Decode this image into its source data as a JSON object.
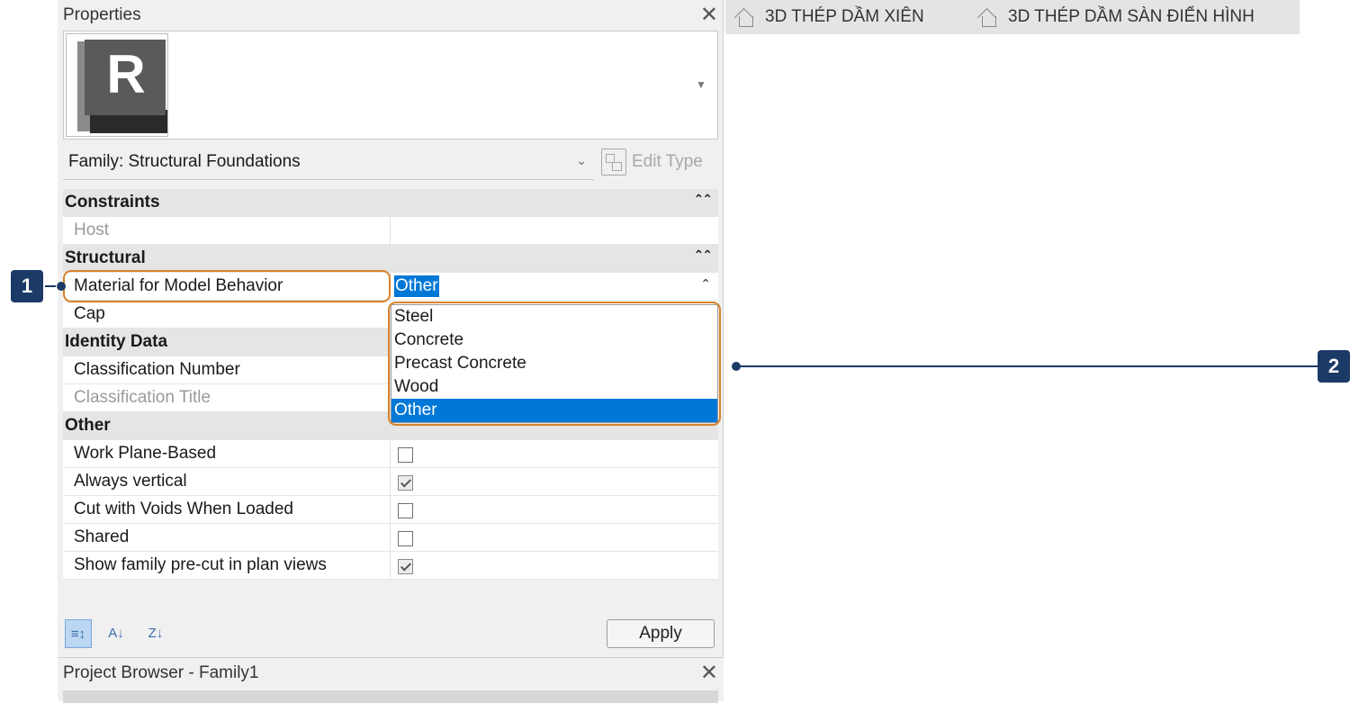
{
  "properties_panel": {
    "title": "Properties",
    "type_logo_letter": "R",
    "family_label": "Family: Structural Foundations",
    "edit_type_label": "Edit Type",
    "groups": {
      "constraints": "Constraints",
      "structural": "Structural",
      "identity": "Identity Data",
      "other": "Other"
    },
    "rows": {
      "host": "Host",
      "material": "Material for Model Behavior",
      "material_value": "Other",
      "cap": "Cap",
      "classification_number": "Classification Number",
      "classification_title": "Classification Title",
      "work_plane": "Work Plane-Based",
      "always_vertical": "Always vertical",
      "cut_voids": "Cut with Voids When Loaded",
      "shared": "Shared",
      "show_precut": "Show family pre-cut in plan views"
    },
    "checkboxes": {
      "work_plane": false,
      "always_vertical": true,
      "cut_voids": false,
      "shared": false,
      "show_precut": true
    },
    "dropdown_options": [
      "Steel",
      "Concrete",
      "Precast Concrete",
      "Wood",
      "Other"
    ],
    "selected_option": "Other",
    "apply_label": "Apply"
  },
  "project_browser": {
    "title": "Project Browser - Family1"
  },
  "tabs": [
    "3D THÉP DẦM XIÊN",
    "3D THÉP DẦM SÀN ĐIỂN HÌNH"
  ],
  "callouts": [
    "1",
    "2"
  ],
  "colors": {
    "highlight": "#d6822a",
    "callout": "#1b3a66",
    "selection": "#0078d7"
  }
}
